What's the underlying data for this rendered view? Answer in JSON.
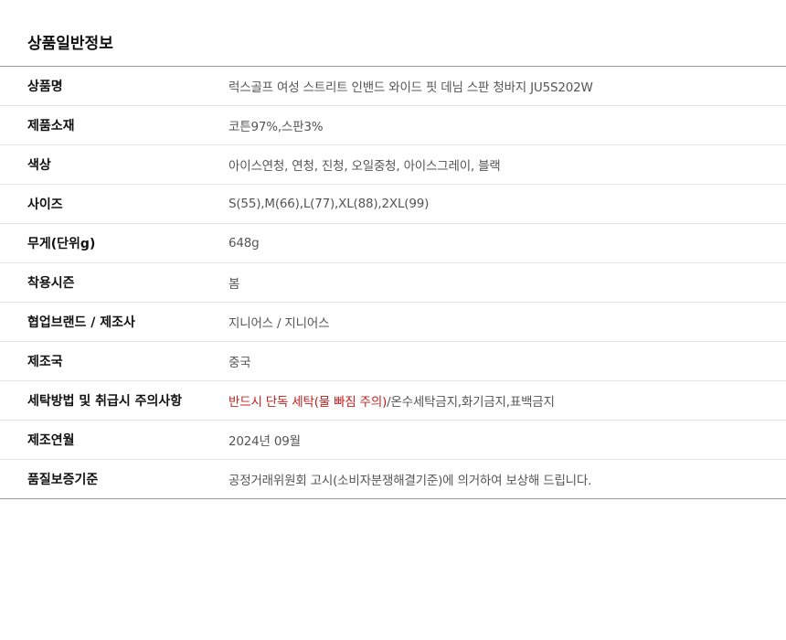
{
  "section": {
    "title": "상품일반정보"
  },
  "colors": {
    "warning": "#c0211e",
    "label": "#111111",
    "value": "#555555"
  },
  "rows": [
    {
      "label": "상품명",
      "value": "럭스골프 여성 스트리트 인밴드 와이드 핏 데님 스판 청바지 JU5S202W"
    },
    {
      "label": "제품소재",
      "value": "코튼97%,스판3%"
    },
    {
      "label": "색상",
      "value": "아이스연청, 연청, 진청, 오일중청, 아이스그레이, 블랙"
    },
    {
      "label": "사이즈",
      "value": "S(55),M(66),L(77),XL(88),2XL(99)"
    },
    {
      "label": "무게(단위g)",
      "value": "648g"
    },
    {
      "label": "착용시즌",
      "value": "봄"
    },
    {
      "label": "협업브랜드 / 제조사",
      "value": "지니어스 / 지니어스"
    },
    {
      "label": "제조국",
      "value": "중국"
    },
    {
      "label": "세탁방법 및 취급시 주의사항",
      "value_warning": "반드시 단독 세탁(물 빠짐 주의)",
      "value": "/온수세탁금지,화기금지,표백금지"
    },
    {
      "label": "제조연월",
      "value": "2024년 09월"
    },
    {
      "label": "품질보증기준",
      "value": "공정거래위원회 고시(소비자분쟁해결기준)에 의거하여  보상해 드립니다."
    }
  ]
}
